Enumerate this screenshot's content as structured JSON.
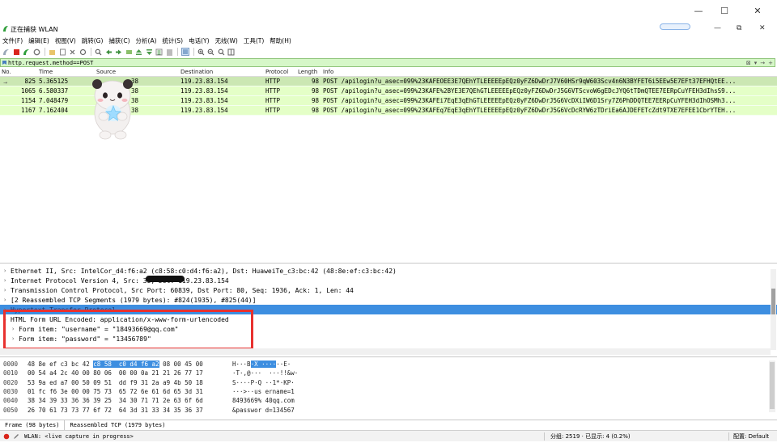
{
  "window": {
    "title": "正在捕获 WLAN",
    "controls": [
      "—",
      "☐",
      "✕"
    ],
    "mdi_controls": [
      "—",
      "⧉",
      "✕"
    ]
  },
  "menu": [
    "文件(F)",
    "编辑(E)",
    "视图(V)",
    "跳转(G)",
    "捕获(C)",
    "分析(A)",
    "统计(S)",
    "电话(Y)",
    "无线(W)",
    "工具(T)",
    "帮助(H)"
  ],
  "filter": {
    "value": "http.request.method==POST"
  },
  "packet_list": {
    "columns": [
      "No.",
      "Time",
      "Source",
      "Destination",
      "Protocol",
      "Length",
      "Info"
    ],
    "rows": [
      {
        "no": "825",
        "time": "5.365125",
        "src": "38",
        "dst": "119.23.83.154",
        "proto": "HTTP",
        "len": "98",
        "info": "POST /apilogin?u_asec=099%23KAFEOEE3E7QEhYTLEEEEEpEQz0yFZ6DwDrJ7V60HSr9qW603Scv4n6N3BYFET6i5EEw5E7EFt37EFHQtEE..."
      },
      {
        "no": "1065",
        "time": "6.580337",
        "src": "38",
        "dst": "119.23.83.154",
        "proto": "HTTP",
        "len": "98",
        "info": "POST /apilogin?u_asec=099%23KAFE%2BYE3E7QEhGTLEEEEEpEQz0yFZ6DwDrJ5G6VTScvoW6gEDcJYQ6tTDmQTEE7EERpCuYFEH3dIhsS9..."
      },
      {
        "no": "1154",
        "time": "7.048479",
        "src": "38",
        "dst": "119.23.83.154",
        "proto": "HTTP",
        "len": "98",
        "info": "POST /apilogin?u_asec=099%23KAFEi7EqE3qEhGTLEEEEEpEQz0yFZ6DwDrJ5G6VcDXiIW6D1Sry7Z6PhDDQTEE7EERpCuYFEH3dIhOSMh3..."
      },
      {
        "no": "1167",
        "time": "7.162404",
        "src": "38",
        "dst": "119.23.83.154",
        "proto": "HTTP",
        "len": "98",
        "info": "POST /apilogin?u_asec=099%23KAFEq7EqE3qEhYTLEEEEEpEQz0yFZ6DwDrJ5G6VcDcRYW6zTDriEa6AJDEFETcZdt9TXE7EFEE1CbrYTEH..."
      }
    ]
  },
  "details": {
    "rows": [
      {
        "text": "Ethernet II, Src: IntelCor_d4:f6:a2 (c8:58:c0:d4:f6:a2), Dst: HuaweiTe_c3:bc:42 (48:8e:ef:c3:bc:42)",
        "expander": "›"
      },
      {
        "text": "Internet Protocol Version 4, Src:                38, Dst: 119.23.83.154",
        "expander": "›"
      },
      {
        "text": "Transmission Control Protocol, Src Port: 60839, Dst Port: 80, Seq: 1936, Ack: 1, Len: 44",
        "expander": "›"
      },
      {
        "text": "[2 Reassembled TCP Segments (1979 bytes): #824(1935), #825(44)]",
        "expander": "›"
      },
      {
        "text": "Hypertext Transfer Protocol",
        "expander": "›"
      },
      {
        "text": "HTML Form URL Encoded: application/x-www-form-urlencoded",
        "expander": "⌄"
      },
      {
        "text": "Form item: \"username\" = \"18493669@qq.com\"",
        "expander": "›"
      },
      {
        "text": "Form item: \"password\" = \"13456789\"",
        "expander": "›"
      }
    ]
  },
  "hex": {
    "rows": [
      {
        "off": "0000",
        "bytes_a": "48 8e ef c3 bc 42 ",
        "bytes_hl": "c8 58  c0 d4 f6 a2",
        "bytes_b": " 08 00 45 00",
        "ascii_a": "H···B",
        "ascii_hl": "·X ····",
        "ascii_b": "··E·"
      },
      {
        "off": "0010",
        "bytes": "00 54 a4 2c 40 00 80 06  00 00 0a 21 21 26 77 17",
        "ascii": "·T·,@···  ···!!&w·"
      },
      {
        "off": "0020",
        "bytes": "53 9a ed a7 00 50 09 51  dd f9 31 2a a9 4b 50 18",
        "ascii": "S····P·Q ··1*·KP·"
      },
      {
        "off": "0030",
        "bytes": "01 fc f6 3e 00 00 75 73  65 72 6e 61 6d 65 3d 31",
        "ascii": "···>··us ername=1"
      },
      {
        "off": "0040",
        "bytes": "38 34 39 33 36 36 39 25  34 30 71 71 2e 63 6f 6d",
        "ascii": "8493669% 40qq.com"
      },
      {
        "off": "0050",
        "bytes": "26 70 61 73 73 77 6f 72  64 3d 31 33 34 35 36 37",
        "ascii": "&passwor d=134567"
      }
    ]
  },
  "byte_tabs": [
    "Frame (98 bytes)",
    "Reassembled TCP (1979 bytes)"
  ],
  "status": {
    "capture": "WLAN: <live capture in progress>",
    "packets": "分组: 2519 · 已显示: 4 (0.2%)",
    "profile": "配置: Default"
  },
  "colors": {
    "http_row": "#e4ffc7",
    "filter_ok": "#d6f7c8",
    "selection": "#3d8ee0",
    "annotation_red": "#e8312f"
  }
}
